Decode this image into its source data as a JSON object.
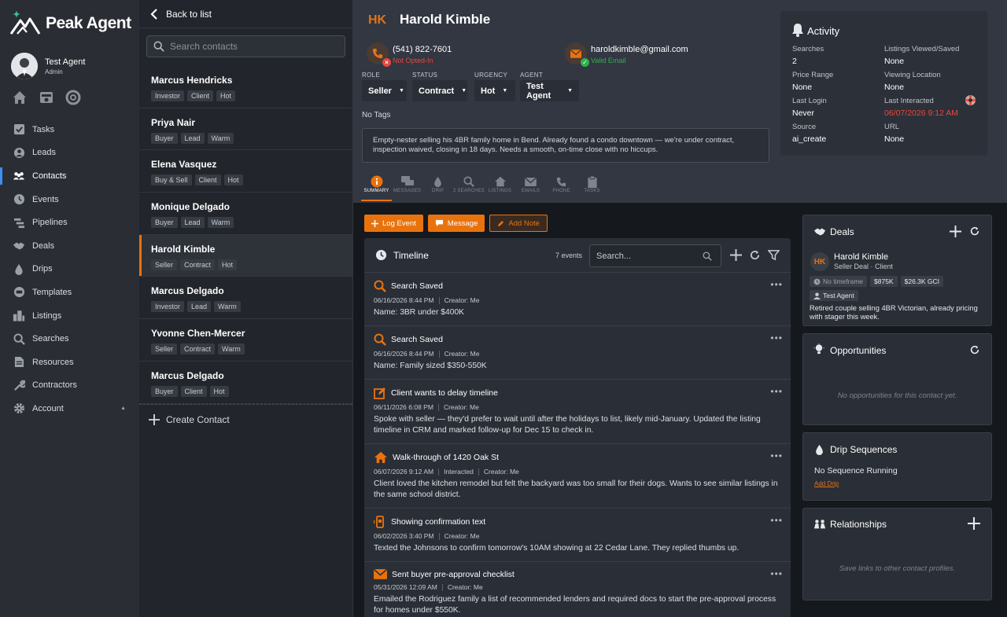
{
  "brand": {
    "name": "Peak Agent",
    "accent": "#e8730e",
    "link": "#3d8ef0"
  },
  "user": {
    "name": "Test Agent",
    "role": "Admin"
  },
  "quick_icons": [
    "home-icon",
    "inbox-icon",
    "support-icon"
  ],
  "nav": [
    {
      "label": "Tasks",
      "icon": "tasks-icon"
    },
    {
      "label": "Leads",
      "icon": "leads-icon"
    },
    {
      "label": "Contacts",
      "icon": "contacts-icon",
      "active": true
    },
    {
      "label": "Events",
      "icon": "clock-icon"
    },
    {
      "label": "Pipelines",
      "icon": "pipeline-icon"
    },
    {
      "label": "Deals",
      "icon": "handshake-icon"
    },
    {
      "label": "Drips",
      "icon": "drop-icon"
    },
    {
      "label": "Templates",
      "icon": "template-icon"
    },
    {
      "label": "Listings",
      "icon": "building-icon"
    },
    {
      "label": "Searches",
      "icon": "search-icon"
    },
    {
      "label": "Resources",
      "icon": "document-icon"
    },
    {
      "label": "Contractors",
      "icon": "wrench-icon"
    },
    {
      "label": "Account",
      "icon": "gear-icon",
      "caret": "▲"
    }
  ],
  "contact_list": {
    "back_label": "Back to list",
    "search_placeholder": "Search contacts",
    "items": [
      {
        "name": "Marcus Hendricks",
        "tags": [
          "Investor",
          "Client",
          "Hot"
        ]
      },
      {
        "name": "Priya Nair",
        "tags": [
          "Buyer",
          "Lead",
          "Warm"
        ]
      },
      {
        "name": "Elena Vasquez",
        "tags": [
          "Buy & Sell",
          "Client",
          "Hot"
        ]
      },
      {
        "name": "Monique Delgado",
        "tags": [
          "Buyer",
          "Lead",
          "Warm"
        ]
      },
      {
        "name": "Harold Kimble",
        "tags": [
          "Seller",
          "Contract",
          "Hot"
        ],
        "active": true
      },
      {
        "name": "Marcus Delgado",
        "tags": [
          "Investor",
          "Lead",
          "Warm"
        ]
      },
      {
        "name": "Yvonne Chen-Mercer",
        "tags": [
          "Seller",
          "Contract",
          "Warm"
        ]
      },
      {
        "name": "Marcus Delgado",
        "tags": [
          "Buyer",
          "Client",
          "Hot"
        ]
      }
    ],
    "create_label": "Create Contact"
  },
  "contact": {
    "initials": "HK",
    "name": "Harold Kimble",
    "phone": "(541) 822-7601",
    "phone_status": "Not Opted-In",
    "email": "haroldkimble@gmail.com",
    "email_status": "Valid Email",
    "fields": [
      {
        "label": "ROLE",
        "value": "Seller"
      },
      {
        "label": "STATUS",
        "value": "Contract"
      },
      {
        "label": "URGENCY",
        "value": "Hot"
      },
      {
        "label": "AGENT",
        "value": "Test Agent"
      }
    ],
    "tags_text": "No Tags",
    "note": "Empty-nester selling his 4BR family home in Bend. Already found a condo downtown — we're under contract, inspection waived, closing in 18 days. Needs a smooth, on-time close with no hiccups."
  },
  "tabs": [
    {
      "label": "SUMMARY",
      "icon": "info-icon",
      "active": true
    },
    {
      "label": "MESSAGES",
      "icon": "chat-icon"
    },
    {
      "label": "DRIP",
      "icon": "drop-icon"
    },
    {
      "label": "2 SEARCHES",
      "icon": "search-icon"
    },
    {
      "label": "LISTINGS",
      "icon": "home-icon"
    },
    {
      "label": "EMAILS",
      "icon": "mail-icon"
    },
    {
      "label": "PHONE",
      "icon": "phone-icon"
    },
    {
      "label": "TASKS",
      "icon": "clipboard-icon"
    }
  ],
  "activity": {
    "title": "Activity",
    "items": [
      {
        "label": "Searches",
        "value": "2"
      },
      {
        "label": "Listings Viewed/Saved",
        "value": "None"
      },
      {
        "label": "Price Range",
        "value": "None"
      },
      {
        "label": "Viewing Location",
        "value": "None"
      },
      {
        "label": "Last Login",
        "value": "Never"
      },
      {
        "label": "Last Interacted",
        "value": "06/07/2026 9:12 AM",
        "highlight": true
      },
      {
        "label": "Source",
        "value": "ai_create"
      },
      {
        "label": "URL",
        "value": "None"
      }
    ]
  },
  "actions": [
    {
      "label": "Log Event",
      "icon": "plus-icon",
      "style": "solid"
    },
    {
      "label": "Message",
      "icon": "chat-icon",
      "style": "solid"
    },
    {
      "label": "Add Note",
      "icon": "pencil-icon",
      "style": "outline"
    }
  ],
  "timeline": {
    "title": "Timeline",
    "count": "7 events",
    "search_placeholder": "Search...",
    "entries": [
      {
        "icon": "search-icon",
        "title": "Search Saved",
        "date": "06/16/2026 8:44 PM",
        "meta": [
          "Creator: Me"
        ],
        "body": "Name: 3BR under $400K"
      },
      {
        "icon": "search-icon",
        "title": "Search Saved",
        "date": "06/16/2026 8:44 PM",
        "meta": [
          "Creator: Me"
        ],
        "body": "Name: Family sized $350-550K"
      },
      {
        "icon": "edit-icon",
        "title": "Client wants to delay timeline",
        "date": "06/11/2026 6:08 PM",
        "meta": [
          "Creator: Me"
        ],
        "body": "Spoke with seller — they'd prefer to wait until after the holidays to list, likely mid-January. Updated the listing timeline in CRM and marked follow-up for Dec 15 to check in."
      },
      {
        "icon": "home-icon",
        "title": "Walk-through of 1420 Oak St",
        "date": "06/07/2026 9:12 AM",
        "meta": [
          "Interacted",
          "Creator: Me"
        ],
        "body": "Client loved the kitchen remodel but felt the backyard was too small for their dogs. Wants to see similar listings in the same school district."
      },
      {
        "icon": "mobile-icon",
        "title": "Showing confirmation text",
        "date": "06/02/2026 3:40 PM",
        "meta": [
          "Creator: Me"
        ],
        "body": "Texted the Johnsons to confirm tomorrow's 10AM showing at 22 Cedar Lane. They replied thumbs up."
      },
      {
        "icon": "mail-icon",
        "title": "Sent buyer pre-approval checklist",
        "date": "05/31/2026 12:09 AM",
        "meta": [
          "Creator: Me"
        ],
        "body": "Emailed the Rodriguez family a list of recommended lenders and required docs to start the pre-approval process for homes under $550K."
      }
    ]
  },
  "deals": {
    "title": "Deals",
    "items": [
      {
        "initials": "HK",
        "name": "Harold Kimble",
        "subtitle": "Seller Deal · Client",
        "timeframe": "No timeframe",
        "price": "$875K",
        "gci": "$26.3K GCI",
        "agent": "Test Agent",
        "note": "Retired couple selling 4BR Victorian, already pricing with stager this week."
      }
    ]
  },
  "opportunities": {
    "title": "Opportunities",
    "empty": "No opportunities for this contact yet."
  },
  "drips": {
    "title": "Drip Sequences",
    "status": "No Sequence Running",
    "add_label": "Add Drip"
  },
  "relationships": {
    "title": "Relationships",
    "empty": "Save links to other contact profiles."
  }
}
